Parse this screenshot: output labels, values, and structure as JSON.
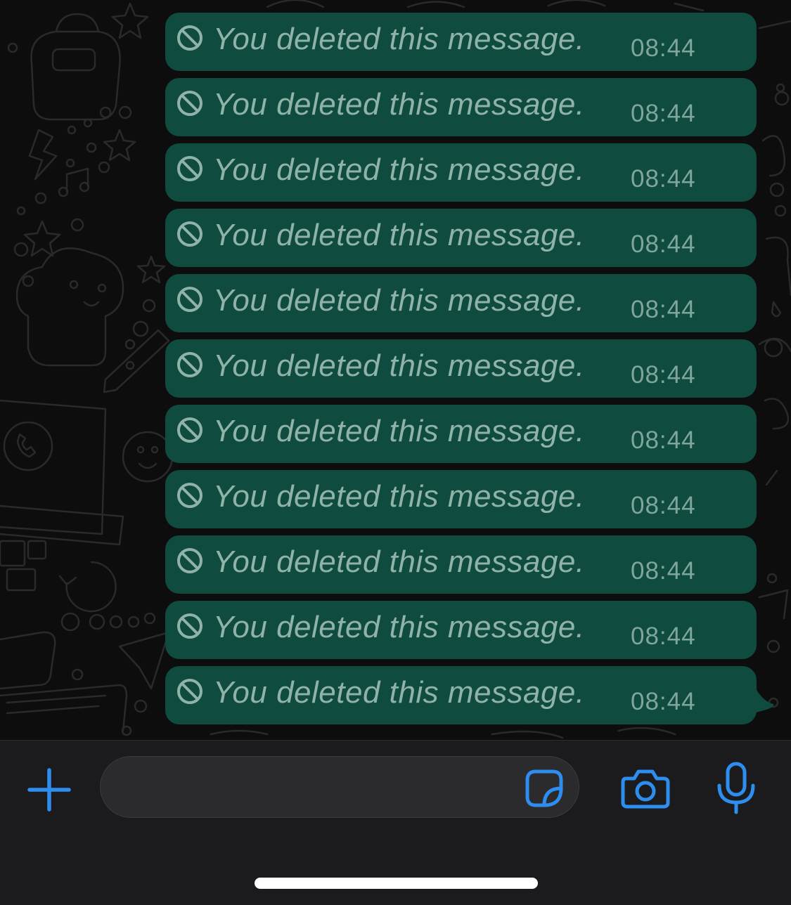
{
  "colors": {
    "bubble": "#0f4b3e",
    "message_text": "#8fb3a9",
    "time_text": "#7ea69c",
    "accent": "#2e8ef0",
    "input_bar": "#1b1b1d",
    "input_field": "#2b2b2e"
  },
  "messages": [
    {
      "text": "You deleted this message.",
      "time": "08:44",
      "icon": "ban-icon"
    },
    {
      "text": "You deleted this message.",
      "time": "08:44",
      "icon": "ban-icon"
    },
    {
      "text": "You deleted this message.",
      "time": "08:44",
      "icon": "ban-icon"
    },
    {
      "text": "You deleted this message.",
      "time": "08:44",
      "icon": "ban-icon"
    },
    {
      "text": "You deleted this message.",
      "time": "08:44",
      "icon": "ban-icon"
    },
    {
      "text": "You deleted this message.",
      "time": "08:44",
      "icon": "ban-icon"
    },
    {
      "text": "You deleted this message.",
      "time": "08:44",
      "icon": "ban-icon"
    },
    {
      "text": "You deleted this message.",
      "time": "08:44",
      "icon": "ban-icon"
    },
    {
      "text": "You deleted this message.",
      "time": "08:44",
      "icon": "ban-icon"
    },
    {
      "text": "You deleted this message.",
      "time": "08:44",
      "icon": "ban-icon"
    },
    {
      "text": "You deleted this message.",
      "time": "08:44",
      "icon": "ban-icon"
    }
  ],
  "input_bar": {
    "message_value": "",
    "message_placeholder": "",
    "icons": {
      "attach": "plus-icon",
      "sticker": "sticker-icon",
      "camera": "camera-icon",
      "microphone": "microphone-icon"
    }
  }
}
